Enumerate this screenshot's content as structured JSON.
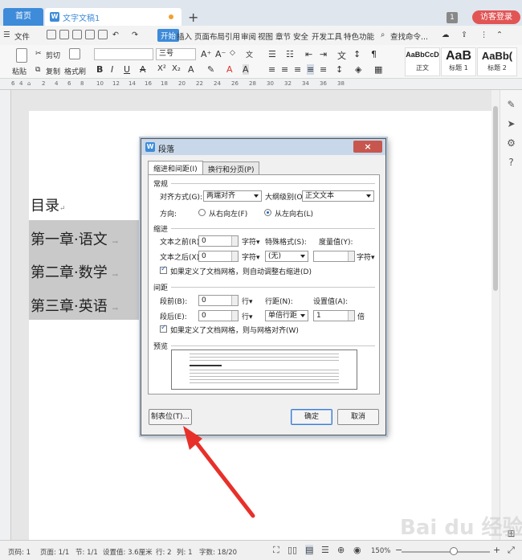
{
  "titlebar": {
    "home_tab": "首页",
    "doc_tab_icon": "W",
    "doc_tab": "文字文稿1",
    "add_tab": "+",
    "window_count": "1",
    "login": "访客登录"
  },
  "menubar": {
    "file": "文件",
    "items": [
      "开始",
      "插入",
      "页面布局",
      "引用",
      "审阅",
      "视图",
      "章节",
      "安全",
      "开发工具",
      "特色功能"
    ],
    "search": "查找命令..."
  },
  "ribbon": {
    "cut": "剪切",
    "copy": "复制",
    "paste": "粘贴",
    "format_painter": "格式刷",
    "font_size": "三号",
    "bold": "B",
    "italic": "I",
    "underline": "U",
    "font_color_a": "A",
    "styles": [
      {
        "preview": "AaBbCcD",
        "name": "正文"
      },
      {
        "preview": "AaB",
        "name": "标题 1"
      },
      {
        "preview": "AaBb(",
        "name": "标题 2"
      }
    ]
  },
  "ruler": [
    "6",
    "4",
    "2",
    "2",
    "4",
    "6",
    "8",
    "10",
    "12",
    "14",
    "16",
    "18",
    "20",
    "22",
    "24",
    "26",
    "28",
    "30",
    "32",
    "34",
    "36",
    "38"
  ],
  "document": {
    "lines": [
      "目录",
      "第一章·语文",
      "第二章·数学",
      "第三章·英语"
    ],
    "pilcrow": "↵",
    "arrow_mark": "→"
  },
  "dialog": {
    "icon": "W",
    "title": "段落",
    "close": "×",
    "tabs": [
      "缩进和间距(I)",
      "换行和分页(P)"
    ],
    "general": {
      "section": "常规",
      "align_label": "对齐方式(G):",
      "align_value": "两端对齐",
      "outline_label": "大纲级别(O):",
      "outline_value": "正文文本",
      "direction_label": "方向:",
      "rtl": "从右向左(F)",
      "ltr": "从左向右(L)"
    },
    "indent": {
      "section": "缩进",
      "before_label": "文本之前(R):",
      "before_value": "0",
      "before_unit": "字符▾",
      "after_label": "文本之后(X):",
      "after_value": "0",
      "after_unit": "字符▾",
      "special_label": "特殊格式(S):",
      "special_value": "(无)",
      "measure_label": "度量值(Y):",
      "measure_value": "",
      "measure_unit": "字符▾",
      "grid_check": "如果定义了文档网格，则自动调整右缩进(D)"
    },
    "spacing": {
      "section": "间距",
      "before_label": "段前(B):",
      "before_value": "0",
      "before_unit": "行▾",
      "after_label": "段后(E):",
      "after_value": "0",
      "after_unit": "行▾",
      "line_label": "行距(N):",
      "line_value": "单倍行距",
      "set_label": "设置值(A):",
      "set_value": "1",
      "set_unit": "倍",
      "grid_check": "如果定义了文档网格，则与网格对齐(W)"
    },
    "preview_label": "预览",
    "tab_button": "制表位(T)...",
    "ok": "确定",
    "cancel": "取消"
  },
  "statusbar": {
    "page": "页码: 1",
    "pages": "页面: 1/1",
    "section": "节: 1/1",
    "setting": "设置值: 3.6厘米",
    "row": "行: 2",
    "col": "列: 1",
    "words": "字数: 18/20",
    "zoom": "150%"
  },
  "watermark": "Bai du 经验"
}
